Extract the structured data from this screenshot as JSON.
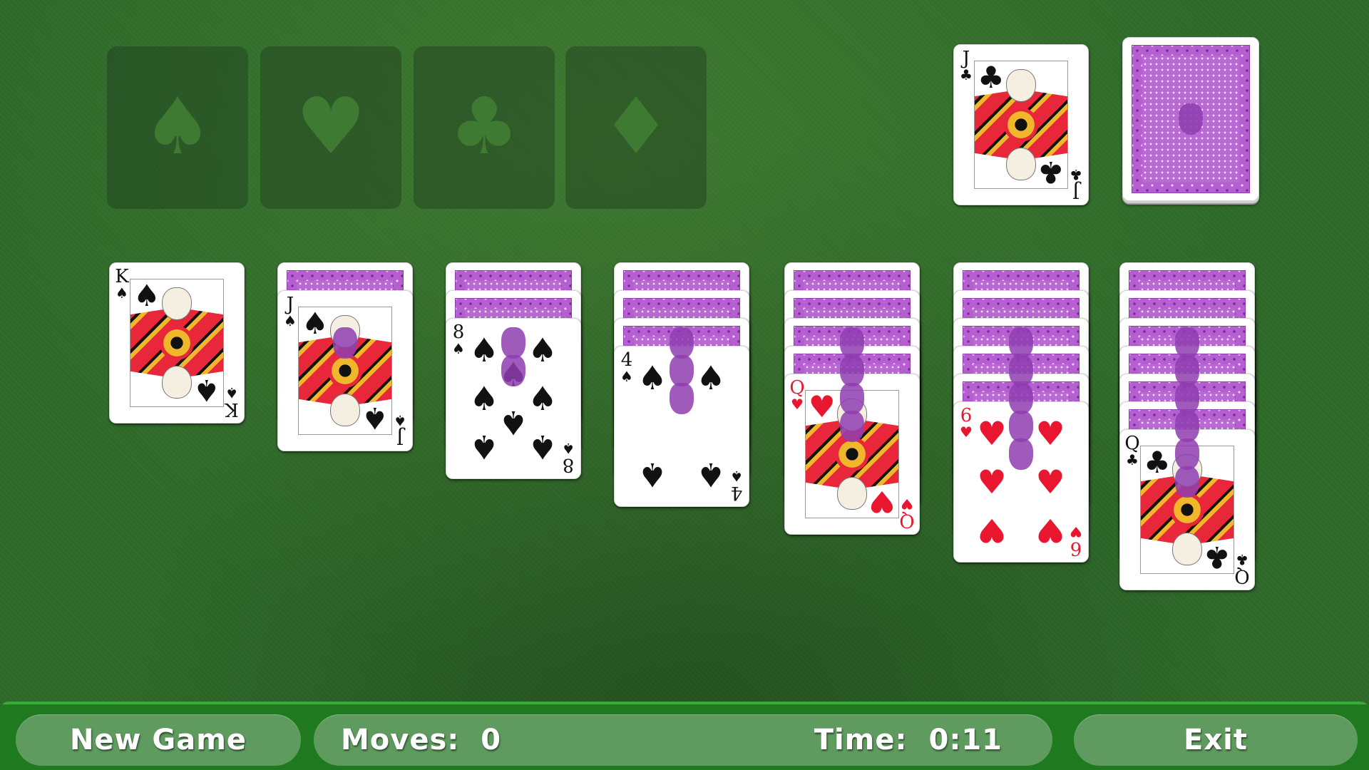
{
  "game": "Solitaire",
  "foundations": [
    {
      "suit": "spades",
      "symbol": "♠"
    },
    {
      "suit": "hearts",
      "symbol": "♥"
    },
    {
      "suit": "clubs",
      "symbol": "♣"
    },
    {
      "suit": "diamonds",
      "symbol": "♦"
    }
  ],
  "waste": {
    "top_card": {
      "rank": "J",
      "suit": "clubs",
      "symbol": "♣",
      "color": "black"
    }
  },
  "stock": {
    "face_down": true
  },
  "tableau": [
    {
      "face_down_count": 0,
      "face_up": {
        "rank": "K",
        "suit": "spades",
        "symbol": "♠",
        "color": "black"
      }
    },
    {
      "face_down_count": 1,
      "face_up": {
        "rank": "J",
        "suit": "spades",
        "symbol": "♠",
        "color": "black"
      }
    },
    {
      "face_down_count": 2,
      "face_up": {
        "rank": "8",
        "suit": "spades",
        "symbol": "♠",
        "color": "black"
      }
    },
    {
      "face_down_count": 3,
      "face_up": {
        "rank": "4",
        "suit": "spades",
        "symbol": "♠",
        "color": "black"
      }
    },
    {
      "face_down_count": 4,
      "face_up": {
        "rank": "Q",
        "suit": "hearts",
        "symbol": "♥",
        "color": "red"
      }
    },
    {
      "face_down_count": 5,
      "face_up": {
        "rank": "6",
        "suit": "hearts",
        "symbol": "♥",
        "color": "red"
      }
    },
    {
      "face_down_count": 6,
      "face_up": {
        "rank": "Q",
        "suit": "clubs",
        "symbol": "♣",
        "color": "black"
      }
    }
  ],
  "bottom_bar": {
    "new_game_label": "New Game",
    "moves_label": "Moves:",
    "moves_value": "0",
    "time_label": "Time:",
    "time_value": "0:11",
    "exit_label": "Exit"
  },
  "colors": {
    "felt": "#2f6a2a",
    "bar": "#1f7a1f",
    "card_back": "#b65fd1",
    "red_suit": "#e8172f",
    "black_suit": "#111111"
  }
}
